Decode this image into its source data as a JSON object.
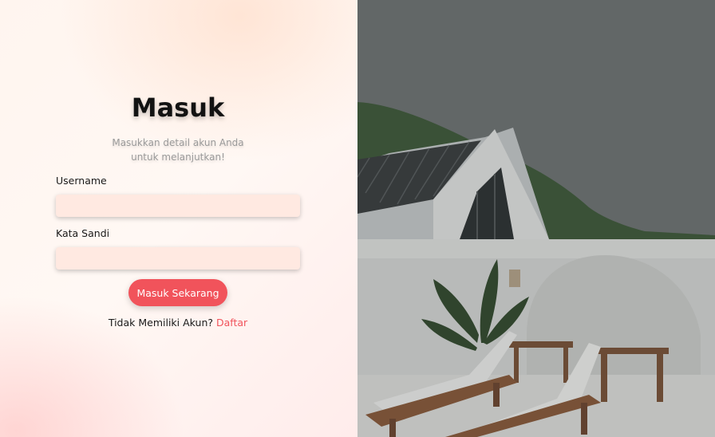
{
  "login": {
    "title": "Masuk",
    "subtitle": "Masukkan detail akun Anda untuk melanjutkan!",
    "username_label": "Username",
    "username_value": "",
    "password_label": "Kata Sandi",
    "password_value": "",
    "submit_label": "Masuk Sekarang",
    "signup_prompt": "Tidak Memiliki Akun?",
    "signup_link": "Daftar"
  },
  "colors": {
    "accent": "#f1535b",
    "input_bg": "#ffe9e1"
  }
}
